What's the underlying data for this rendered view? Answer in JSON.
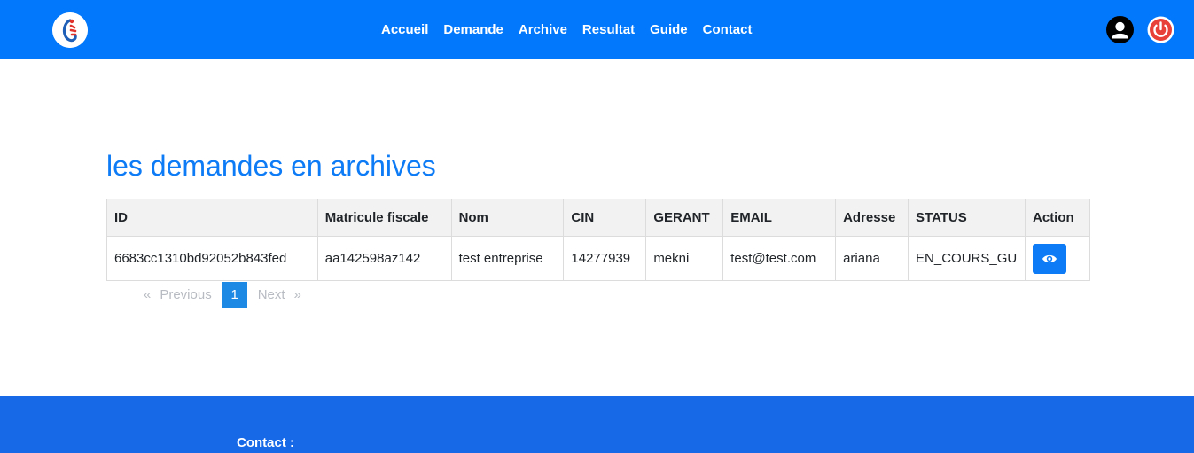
{
  "nav": {
    "links": [
      "Accueil",
      "Demande",
      "Archive",
      "Resultat",
      "Guide",
      "Contact"
    ]
  },
  "page": {
    "title": "les demandes en archives"
  },
  "table": {
    "headers": [
      "ID",
      "Matricule fiscale",
      "Nom",
      "CIN",
      "GERANT",
      "EMAIL",
      "Adresse",
      "STATUS",
      "Action"
    ],
    "rows": [
      [
        "6683cc1310bd92052b843fed",
        "aa142598az142",
        "test entreprise",
        "14277939",
        "mekni",
        "test@test.com",
        "ariana",
        "EN_COURS_GU"
      ]
    ]
  },
  "pagination": {
    "prev_arrow": "«",
    "prev_label": "Previous",
    "current": "1",
    "next_label": "Next",
    "next_arrow": "»"
  },
  "footer": {
    "contact_label": "Contact :"
  },
  "colors": {
    "navbar": "#0279fc",
    "accent": "#0d7bf5",
    "footer": "#1769e8",
    "pagination_active": "#1e88e5"
  },
  "icons": {
    "logo": "brand-logo-icon",
    "user": "user-avatar-icon",
    "logout": "power-icon",
    "view": "eye-icon"
  }
}
